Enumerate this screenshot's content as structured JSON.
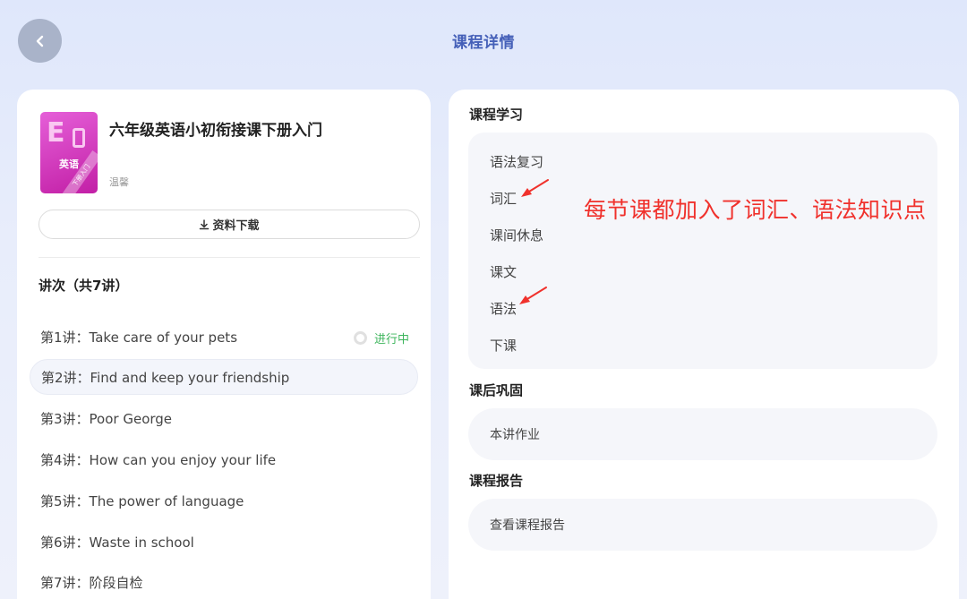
{
  "header": {
    "title": "课程详情"
  },
  "course": {
    "title": "六年级英语小初衔接课下册入门",
    "teacher": "温馨",
    "cover_subject": "英语",
    "cover_ribbon": "下册入门",
    "download_label": "资料下载"
  },
  "lessons": {
    "heading": "讲次（共7讲）",
    "items": [
      {
        "label": "第1讲：Take care of your pets",
        "status": "进行中"
      },
      {
        "label": "第2讲：Find and keep your friendship"
      },
      {
        "label": "第3讲：Poor George"
      },
      {
        "label": "第4讲：How can you enjoy your life"
      },
      {
        "label": "第5讲：The power of language"
      },
      {
        "label": "第6讲：Waste in school"
      },
      {
        "label": "第7讲：阶段自检"
      }
    ]
  },
  "study": {
    "heading": "课程学习",
    "items": [
      "语法复习",
      "词汇",
      "课间休息",
      "课文",
      "语法",
      "下课"
    ]
  },
  "after_class": {
    "heading": "课后巩固",
    "item": "本讲作业"
  },
  "report": {
    "heading": "课程报告",
    "item": "查看课程报告"
  },
  "annotation": "每节课都加入了词汇、语法知识点",
  "colors": {
    "title_blue": "#4560b8",
    "status_green": "#3db55c",
    "annotation_red": "#f0312c",
    "cover_magenta": "#c21fa6"
  }
}
